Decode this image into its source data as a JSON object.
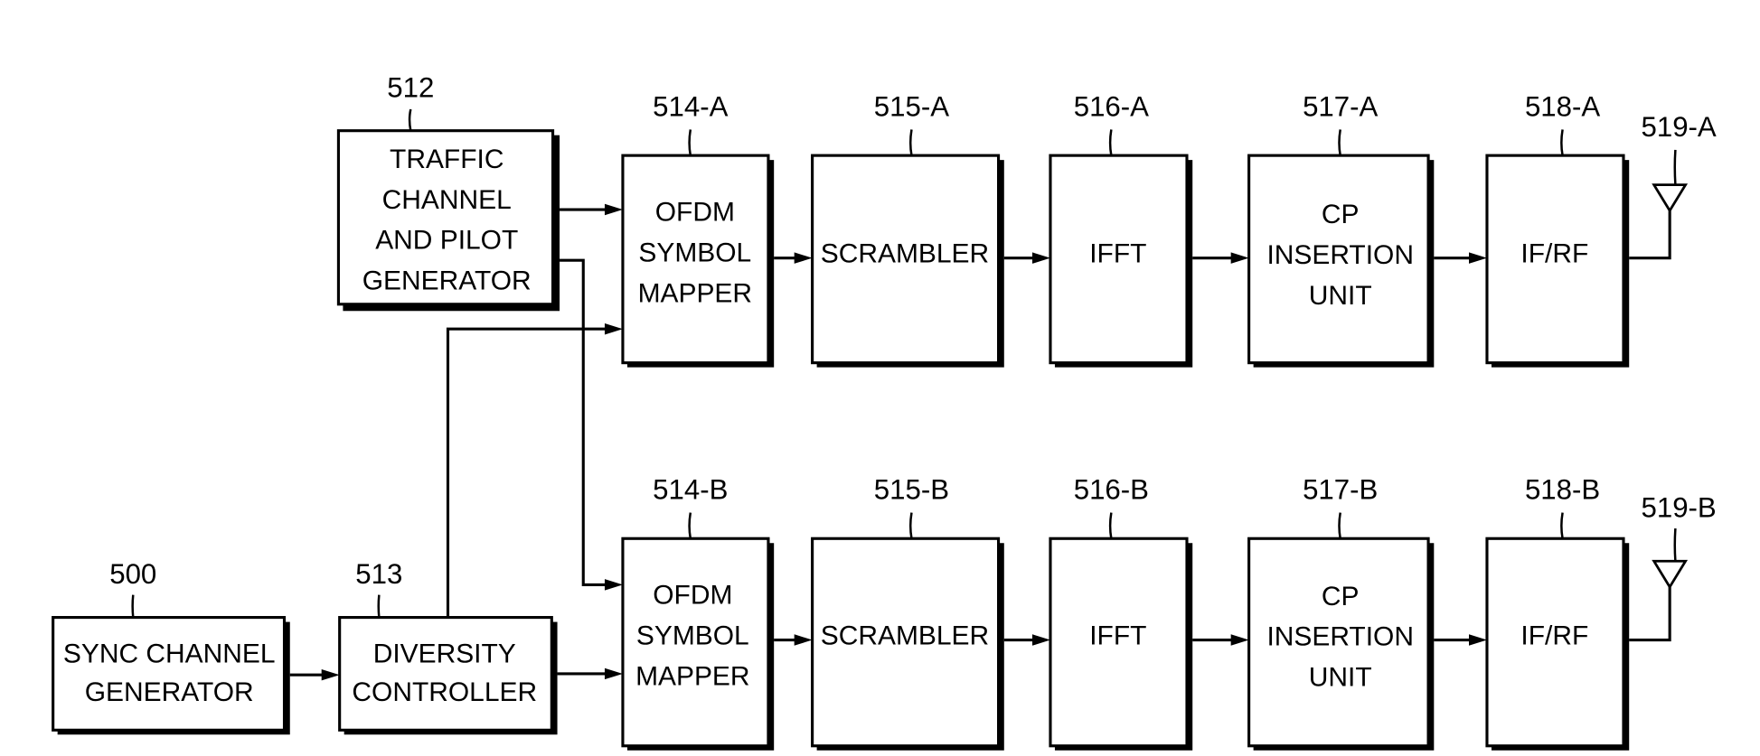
{
  "diagram": {
    "blocks": [
      {
        "id": "512",
        "ref": "512",
        "lines": [
          "TRAFFIC",
          "CHANNEL",
          "AND PILOT",
          "GENERATOR"
        ]
      },
      {
        "id": "500",
        "ref": "500",
        "lines": [
          "SYNC CHANNEL",
          "GENERATOR"
        ]
      },
      {
        "id": "513",
        "ref": "513",
        "lines": [
          "DIVERSITY",
          "CONTROLLER"
        ]
      },
      {
        "id": "514-A",
        "ref": "514-A",
        "lines": [
          "OFDM",
          "SYMBOL",
          "MAPPER"
        ]
      },
      {
        "id": "515-A",
        "ref": "515-A",
        "lines": [
          "SCRAMBLER"
        ]
      },
      {
        "id": "516-A",
        "ref": "516-A",
        "lines": [
          "IFFT"
        ]
      },
      {
        "id": "517-A",
        "ref": "517-A",
        "lines": [
          "CP",
          "INSERTION",
          "UNIT"
        ]
      },
      {
        "id": "518-A",
        "ref": "518-A",
        "lines": [
          "IF/RF"
        ]
      },
      {
        "id": "514-B",
        "ref": "514-B",
        "lines": [
          "OFDM",
          "SYMBOL",
          "MAPPER"
        ]
      },
      {
        "id": "515-B",
        "ref": "515-B",
        "lines": [
          "SCRAMBLER"
        ]
      },
      {
        "id": "516-B",
        "ref": "516-B",
        "lines": [
          "IFFT"
        ]
      },
      {
        "id": "517-B",
        "ref": "517-B",
        "lines": [
          "CP",
          "INSERTION",
          "UNIT"
        ]
      },
      {
        "id": "518-B",
        "ref": "518-B",
        "lines": [
          "IF/RF"
        ]
      }
    ],
    "antennas": [
      {
        "id": "519-A",
        "ref": "519-A"
      },
      {
        "id": "519-B",
        "ref": "519-B"
      }
    ]
  }
}
